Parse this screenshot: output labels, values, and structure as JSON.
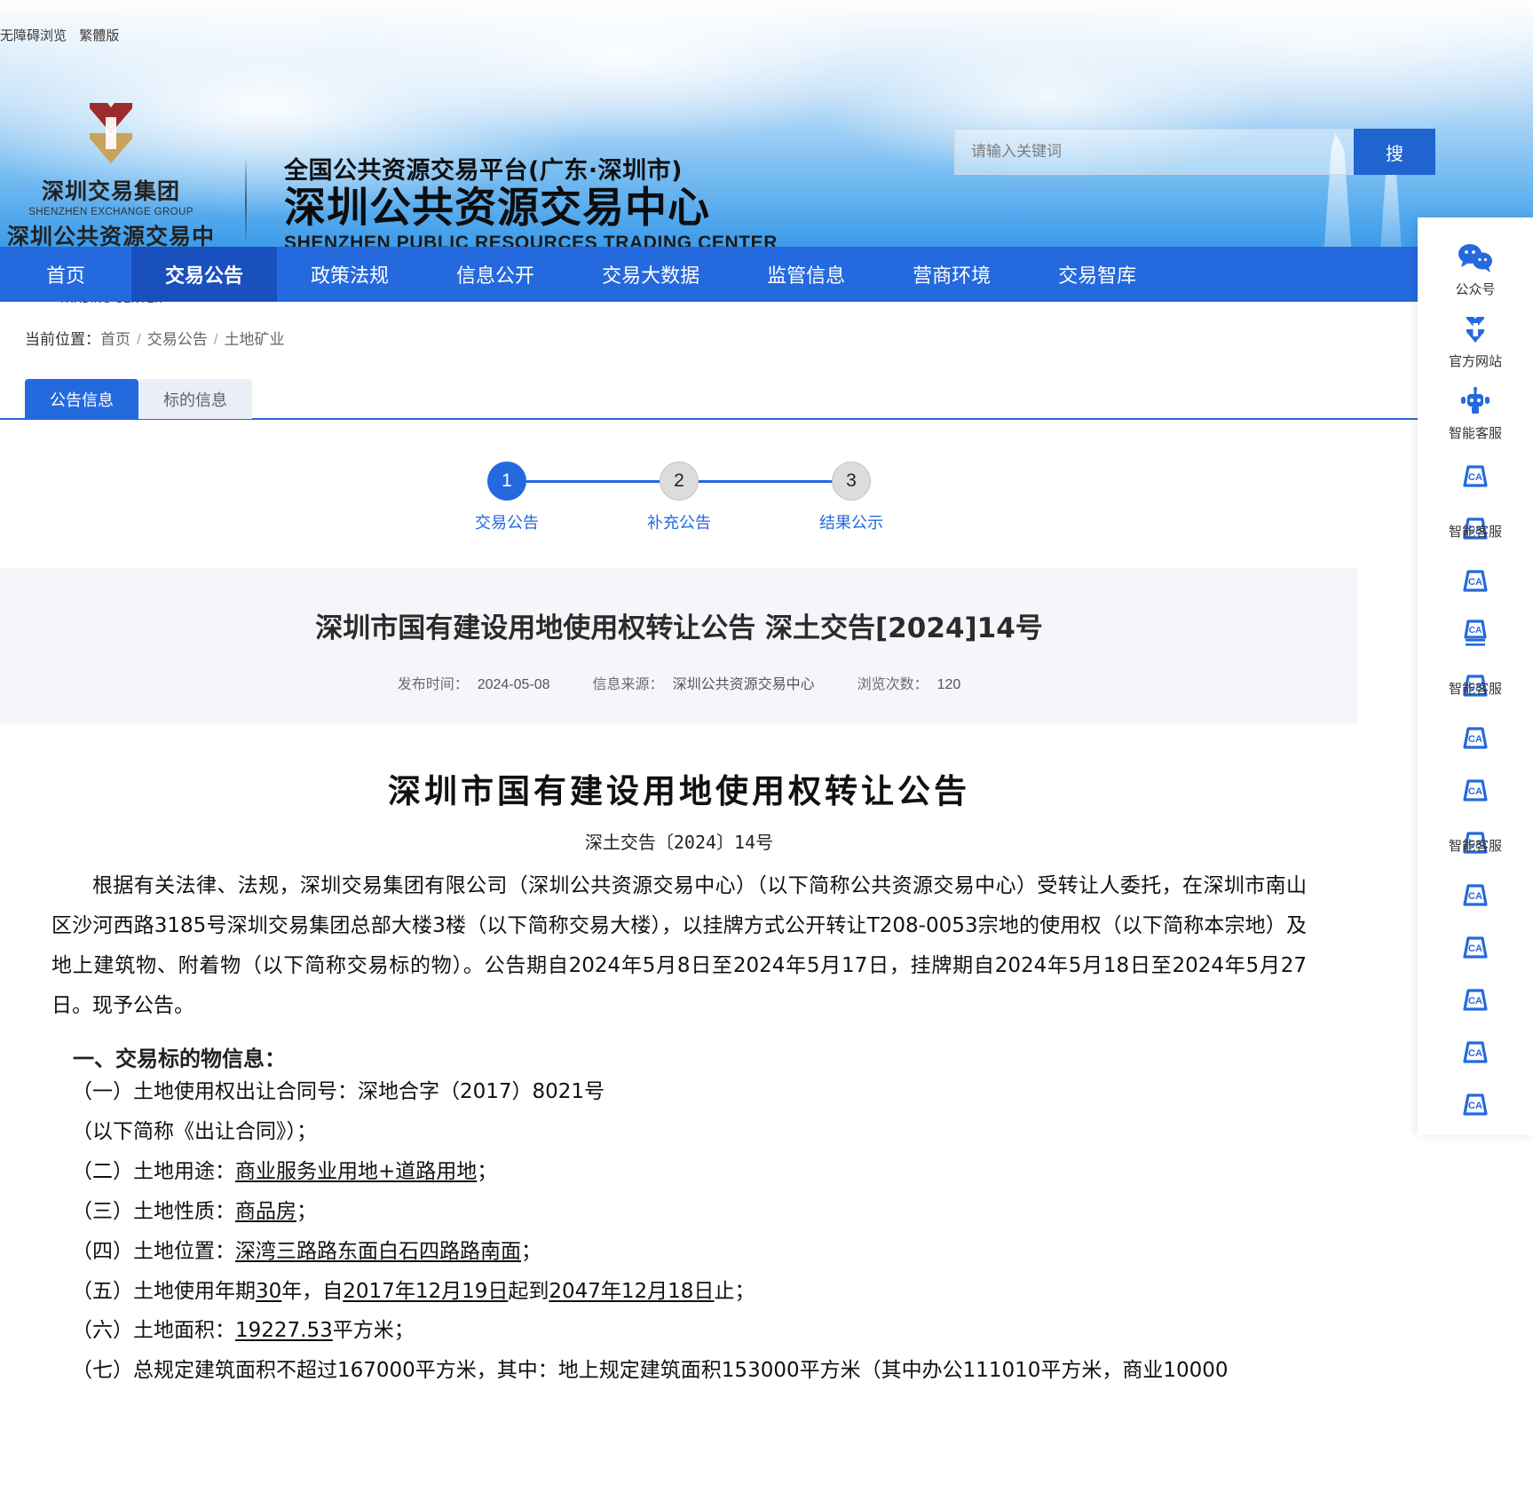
{
  "topbar": {
    "accessibility": "无障碍浏览",
    "traditional": "繁體版"
  },
  "brand": {
    "group_cn": "深圳交易集团",
    "group_en": "SHENZHEN EXCHANGE GROUP",
    "center_cn": "深圳公共资源交易中心",
    "center_en": "SHENZHEN PUBLIC RESOURCES TRADING CENTER",
    "platform_line": "全国公共资源交易平台(广东·深圳市)",
    "site_cn": "深圳公共资源交易中心",
    "site_en": "SHENZHEN PUBLIC RESOURCES TRADING CENTER"
  },
  "search": {
    "placeholder": "请输入关键词",
    "button": "搜"
  },
  "nav": {
    "items": [
      {
        "label": "首页",
        "active": false
      },
      {
        "label": "交易公告",
        "active": true
      },
      {
        "label": "政策法规",
        "active": false
      },
      {
        "label": "信息公开",
        "active": false
      },
      {
        "label": "交易大数据",
        "active": false
      },
      {
        "label": "监管信息",
        "active": false
      },
      {
        "label": "营商环境",
        "active": false
      },
      {
        "label": "交易智库",
        "active": false
      }
    ]
  },
  "breadcrumb": {
    "label": "当前位置：",
    "items": [
      "首页",
      "交易公告",
      "土地矿业"
    ]
  },
  "tabs": [
    {
      "label": "公告信息",
      "active": true
    },
    {
      "label": "标的信息",
      "active": false
    }
  ],
  "stepper": [
    {
      "num": "1",
      "label": "交易公告",
      "active": true
    },
    {
      "num": "2",
      "label": "补充公告",
      "active": false
    },
    {
      "num": "3",
      "label": "结果公示",
      "active": false
    }
  ],
  "doc": {
    "title": "深圳市国有建设用地使用权转让公告 深土交告[2024]14号",
    "meta": [
      {
        "key": "发布时间：",
        "value": "2024-05-08"
      },
      {
        "key": "信息来源：",
        "value": "深圳公共资源交易中心"
      },
      {
        "key": "浏览次数：",
        "value": "120"
      }
    ],
    "article_title": "深圳市国有建设用地使用权转让公告",
    "article_subtitle": "深土交告〔2024〕14号",
    "lead": "根据有关法律、法规，深圳交易集团有限公司（深圳公共资源交易中心）（以下简称公共资源交易中心）受转让人委托，在深圳市南山区沙河西路3185号深圳交易集团总部大楼3楼（以下简称交易大楼），以挂牌方式公开转让T208-0053宗地的使用权（以下简称本宗地）及地上建筑物、附着物（以下简称交易标的物）。公告期自2024年5月8日至2024年5月17日，挂牌期自2024年5月18日至2024年5月27日。现予公告。",
    "section_1_heading": "一、交易标的物信息：",
    "items": [
      {
        "label": "（一）土地使用权出让合同号：",
        "value": "深地合字（2017）8021号",
        "underline": false
      },
      {
        "label": "（以下简称《出让合同》）；",
        "value": "",
        "underline": false
      },
      {
        "label": "（二）土地用途：",
        "value": "商业服务业用地+道路用地",
        "suffix": "；",
        "underline": true
      },
      {
        "label": "（三）土地性质：",
        "value": "商品房",
        "suffix": "；",
        "underline": true
      },
      {
        "label": "（四）土地位置：",
        "value": "深湾三路路东面白石四路路南面",
        "suffix": "；",
        "underline": true
      },
      {
        "label": "（五）土地使用年期",
        "value": "30",
        "mid": "年，自",
        "value2": "2017年12月19日",
        "mid2": "起到",
        "value3": "2047年12月18日",
        "suffix": "止；",
        "underline": true
      },
      {
        "label": "（六）土地面积：",
        "value": "19227.53",
        "suffix": "平方米；",
        "underline": true
      },
      {
        "label": "（七）总规定建筑面积不超过167000平方米，其中：地上规定建筑面积153000平方米（其中办公111010平方米，商业10000",
        "value": "",
        "underline": true
      }
    ]
  },
  "float_panel": {
    "items": [
      {
        "icon": "wechat-icon",
        "label": "公众号"
      },
      {
        "icon": "official-site-icon",
        "label": "官方网站"
      },
      {
        "icon": "robot-icon",
        "label": "智能客服"
      },
      {
        "icon": "ca-icon",
        "label": ""
      },
      {
        "icon": "ca-icon",
        "label": "智能客服"
      },
      {
        "icon": "ca-icon",
        "label": ""
      },
      {
        "icon": "ca-doc-icon",
        "label": ""
      },
      {
        "icon": "ca-icon",
        "label": "智能客服"
      },
      {
        "icon": "ca-icon",
        "label": ""
      },
      {
        "icon": "ca-icon",
        "label": ""
      },
      {
        "icon": "ca-icon",
        "label": "智能客服"
      },
      {
        "icon": "ca-icon",
        "label": ""
      },
      {
        "icon": "ca-icon",
        "label": ""
      },
      {
        "icon": "ca-icon",
        "label": ""
      },
      {
        "icon": "ca-icon",
        "label": ""
      },
      {
        "icon": "ca-icon",
        "label": ""
      }
    ]
  },
  "colors": {
    "primary": "#2569de",
    "primary_dark": "#1a4fbe",
    "logo_red": "#9e2b2b",
    "logo_gold": "#c9a25c"
  }
}
